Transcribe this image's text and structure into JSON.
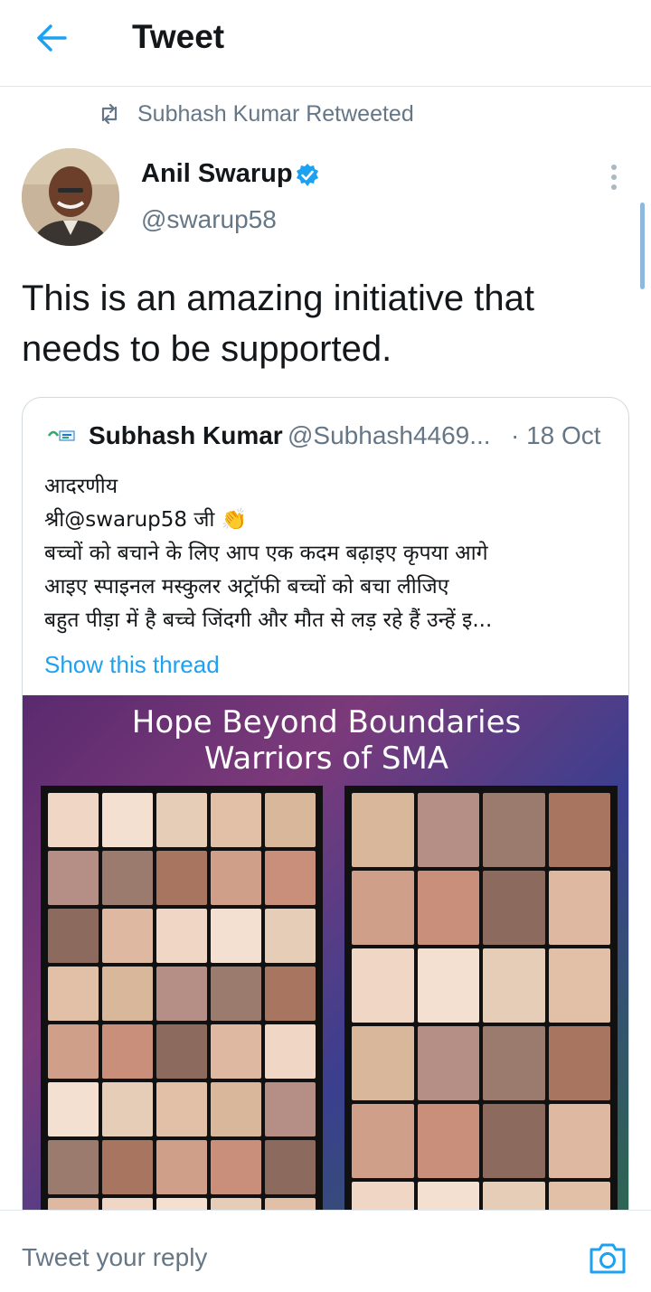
{
  "header": {
    "title": "Tweet",
    "back_icon": "arrow-left-icon"
  },
  "context": {
    "retweet_text": "Subhash Kumar Retweeted"
  },
  "tweet": {
    "author_name": "Anil Swarup",
    "verified": true,
    "handle": "@swarup58",
    "text": "This is an amazing initiative that needs to be supported."
  },
  "quote": {
    "author_name": "Subhash Kumar",
    "handle": "@Subhash4469...",
    "date": "· 18 Oct",
    "lines": [
      "आदरणीय",
      "श्री@swarup58 जी 👏",
      "बच्चों को बचाने के लिए आप एक कदम बढ़ाइए कृपया आगे",
      "आइए स्पाइनल मस्कुलर अट्रॉफी बच्चों को बचा लीजिए",
      "बहुत पीड़ा में है बच्चे जिंदगी और मौत से लड़ रहे हैं उन्हें इ..."
    ],
    "show_thread": "Show this thread",
    "media": {
      "title_line1": "Hope Beyond Boundaries",
      "title_line2": "Warriors of SMA"
    }
  },
  "reply": {
    "placeholder": "Tweet your reply"
  },
  "colors": {
    "accent": "#1da1f2",
    "muted": "#657786",
    "text": "#14171a",
    "border": "#cfd9de"
  }
}
